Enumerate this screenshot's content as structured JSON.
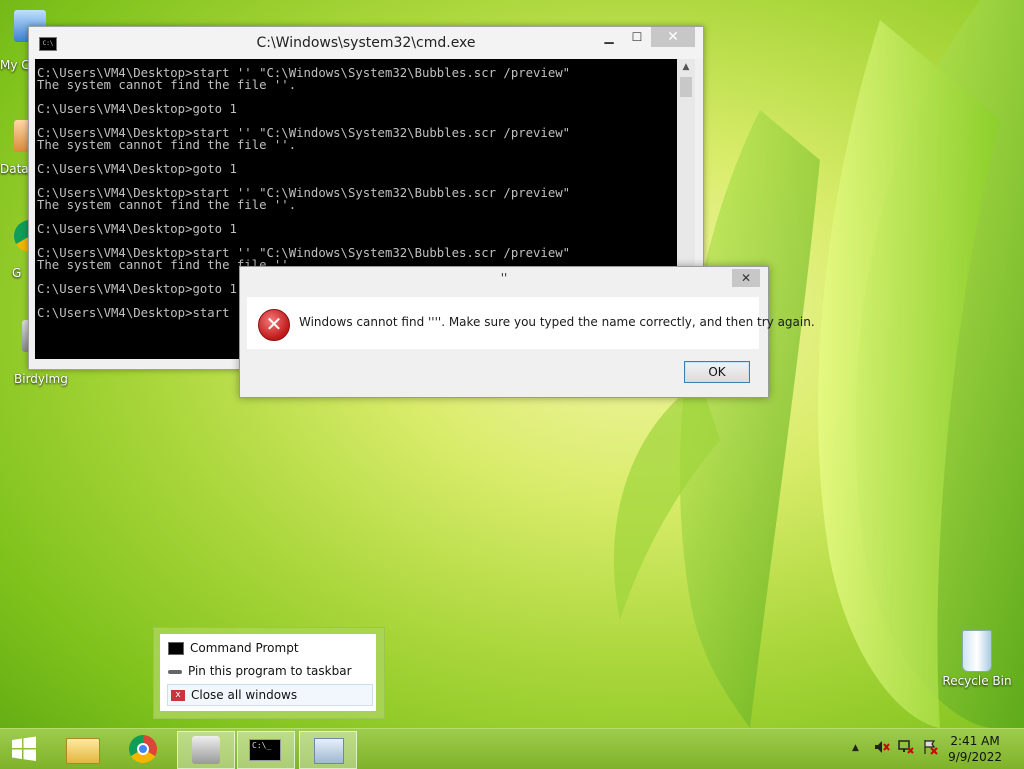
{
  "desktop": {
    "icons": [
      {
        "label": "My C"
      },
      {
        "label": "Data"
      },
      {
        "label": "G"
      },
      {
        "label": "BirdyImg"
      },
      {
        "label": "Recycle Bin"
      }
    ]
  },
  "cmd_window": {
    "title": "C:\\Windows\\system32\\cmd.exe",
    "minimize": "▁",
    "maximize": "☐",
    "close": "✕",
    "output": "C:\\Users\\VM4\\Desktop>start '' \"C:\\Windows\\System32\\Bubbles.scr /preview\"\nThe system cannot find the file ''.\n\nC:\\Users\\VM4\\Desktop>goto 1\n\nC:\\Users\\VM4\\Desktop>start '' \"C:\\Windows\\System32\\Bubbles.scr /preview\"\nThe system cannot find the file ''.\n\nC:\\Users\\VM4\\Desktop>goto 1\n\nC:\\Users\\VM4\\Desktop>start '' \"C:\\Windows\\System32\\Bubbles.scr /preview\"\nThe system cannot find the file ''.\n\nC:\\Users\\VM4\\Desktop>goto 1\n\nC:\\Users\\VM4\\Desktop>start '' \"C:\\Windows\\System32\\Bubbles.scr /preview\"\nThe system cannot find the file ''.\n\nC:\\Users\\VM4\\Desktop>goto 1\n\nC:\\Users\\VM4\\Desktop>start"
  },
  "error_dialog": {
    "title": "''",
    "close": "✕",
    "message": "Windows cannot find ''''. Make sure you typed the name correctly, and then try again.",
    "ok_label": "OK"
  },
  "jump_list": {
    "items": [
      {
        "label": "Command Prompt",
        "icon": "cmd-icon"
      },
      {
        "label": "Pin this program to taskbar",
        "icon": "pin-icon"
      },
      {
        "label": "Close all windows",
        "icon": "close-icon"
      }
    ]
  },
  "taskbar": {
    "buttons": [
      "start-icon",
      "file-explorer-icon",
      "chrome-icon",
      "birdy-icon",
      "cmd-icon",
      "monitor-app-icon"
    ],
    "tray_arrow": "▲",
    "clock_time": "2:41 AM",
    "clock_date": "9/9/2022"
  },
  "colors": {
    "accent_green": "#8fc33a",
    "error_red": "#c01818",
    "console_bg": "#000000",
    "console_fg": "#c0c0c0"
  }
}
